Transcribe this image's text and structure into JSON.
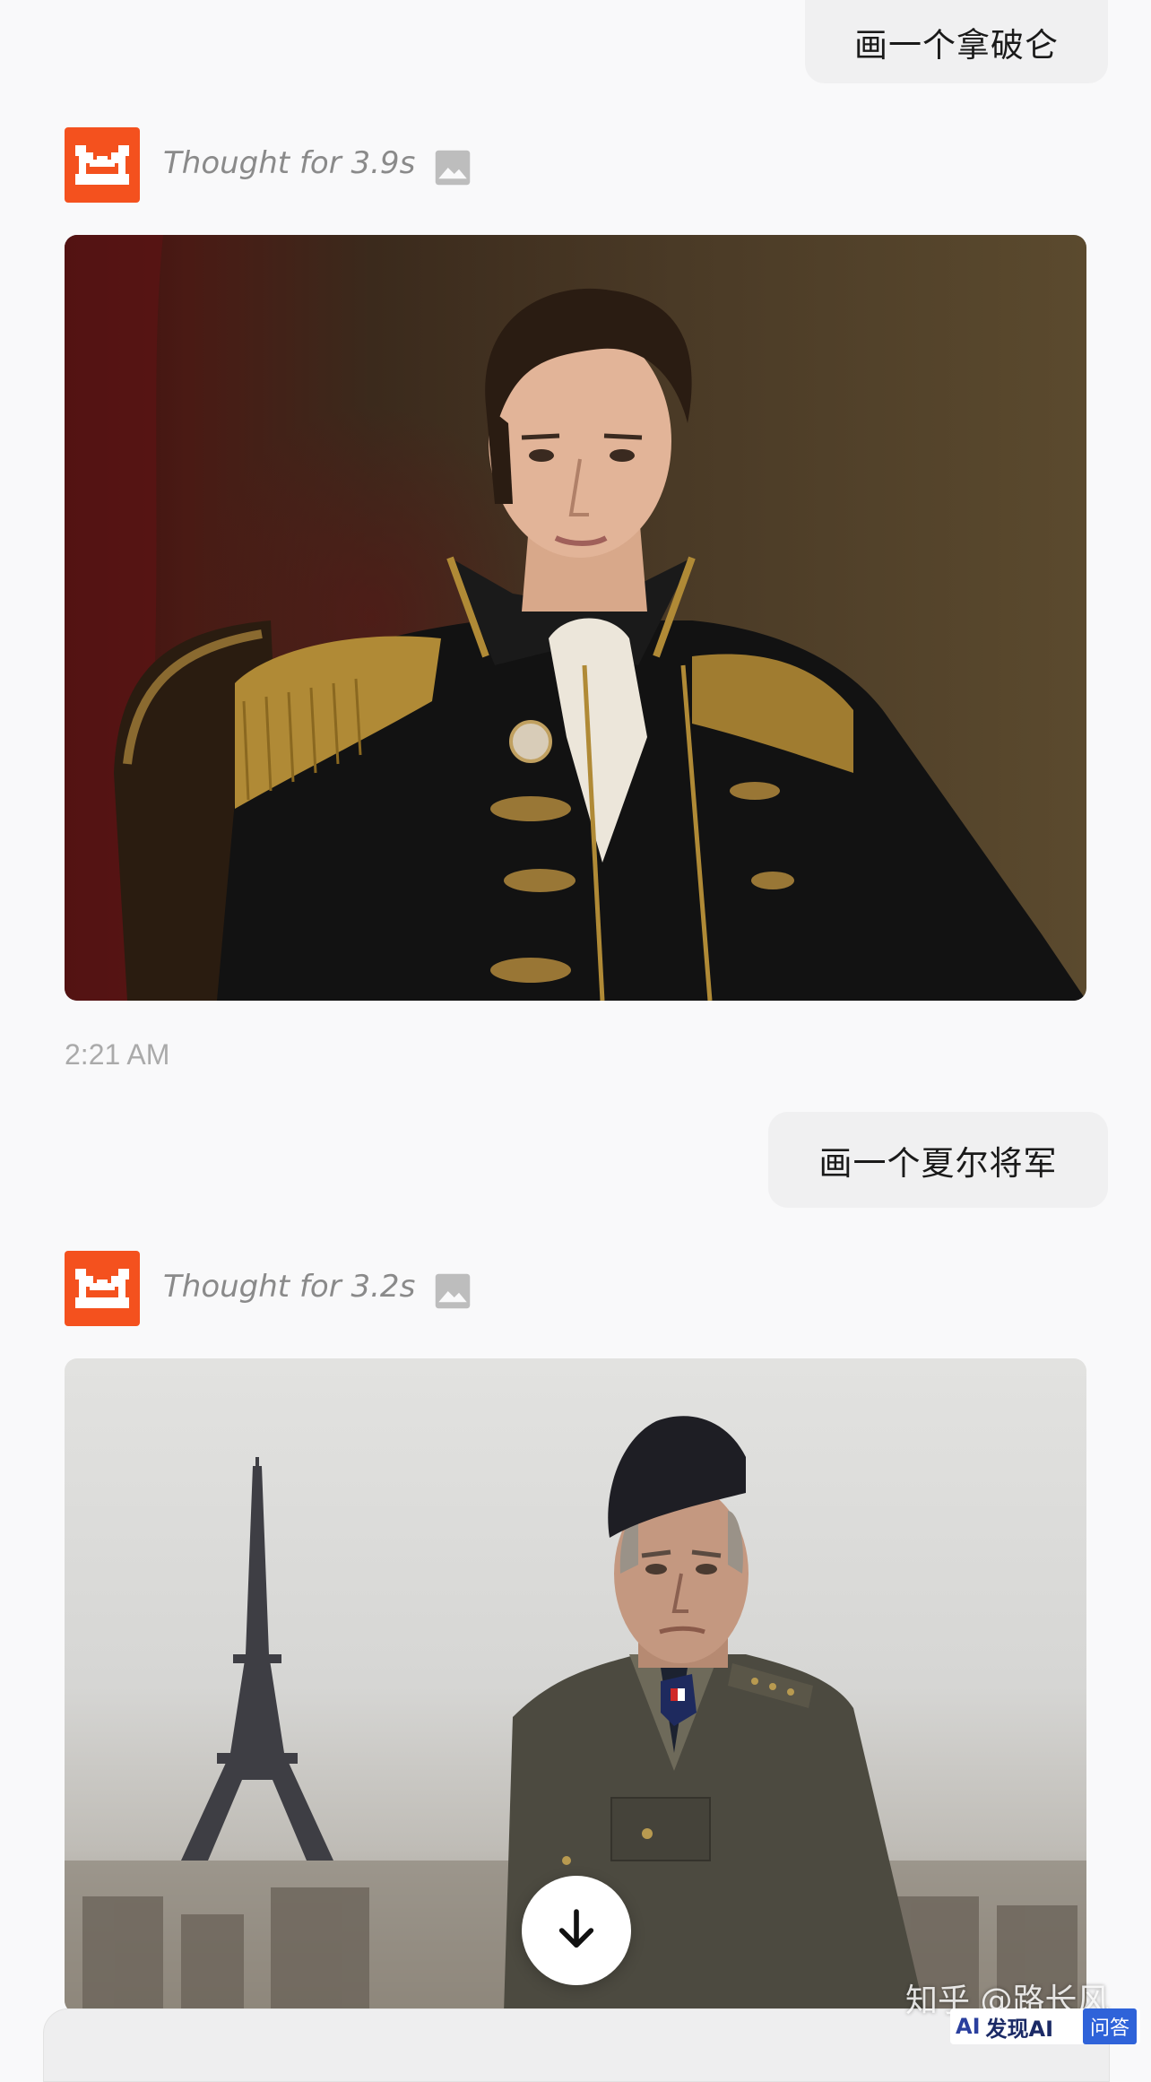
{
  "conversation": {
    "messages": [
      {
        "role": "user",
        "text": "画一个拿破仑"
      },
      {
        "role": "assistant",
        "thought": "Thought for 3.9s",
        "image_alt": "portrait of Napoleon in black gold-embroidered uniform"
      },
      {
        "role": "meta",
        "timestamp": "2:21 AM"
      },
      {
        "role": "user",
        "text": "画一个夏尔将军"
      },
      {
        "role": "assistant",
        "thought": "Thought for 3.2s",
        "image_alt": "general in kepi with Eiffel Tower behind"
      }
    ]
  },
  "icons": {
    "avatar": "assistant-avatar-icon",
    "image": "image-icon",
    "scroll": "arrow-down-icon"
  },
  "colors": {
    "accent": "#f4511e",
    "background": "#f9f9fa",
    "bubble": "#f0f0f1"
  },
  "watermark": {
    "text": "知乎 @路长风",
    "badge_logo": "AI",
    "badge_name": "发现AI",
    "badge_tag": "问答"
  }
}
